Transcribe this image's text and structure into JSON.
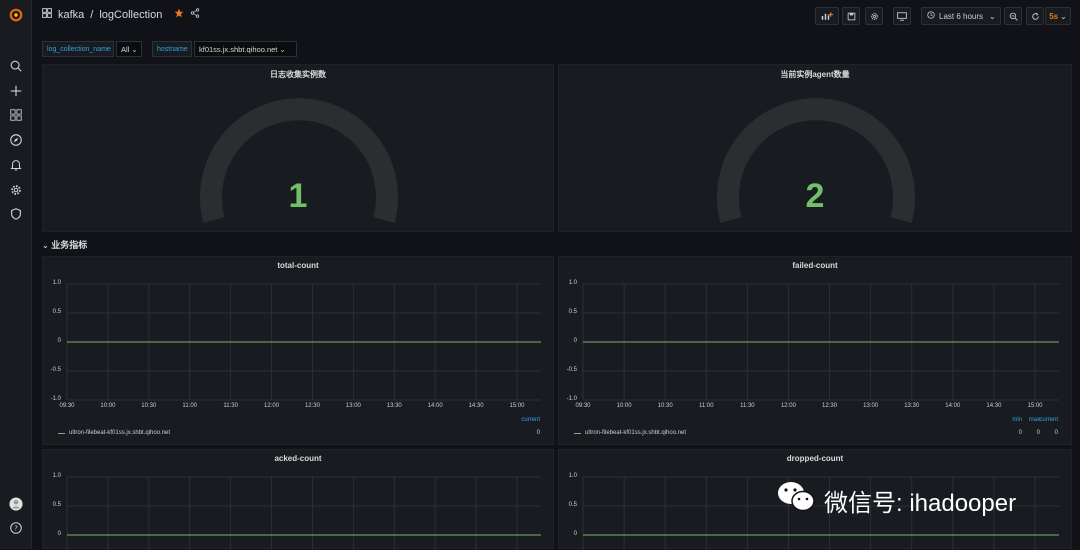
{
  "breadcrumb": {
    "folder": "kafka",
    "sep": "/",
    "dashboard": "logCollection"
  },
  "toolbar": {
    "time_range": "Last 6 hours",
    "refresh": "5s"
  },
  "variables": [
    {
      "label": "log_collection_name",
      "value": "All"
    },
    {
      "label": "hostname",
      "value": "kf01ss.jx.shbt.qihoo.net"
    }
  ],
  "gauges": [
    {
      "title": "日志收集实例数",
      "value": "1"
    },
    {
      "title": "当前实例agent数量",
      "value": "2"
    }
  ],
  "row_title": "业务指标",
  "graphs": [
    {
      "title": "total-count",
      "legend_headers": [
        "current"
      ],
      "legend_series": "ultron-filebeat-kf01ss.jx.shbt.qihoo.net",
      "legend_values": [
        "0"
      ]
    },
    {
      "title": "failed-count",
      "legend_headers": [
        "min",
        "max",
        "current"
      ],
      "legend_series": "ultron-filebeat-kf01ss.jx.shbt.qihoo.net",
      "legend_values": [
        "0",
        "0",
        "0"
      ]
    },
    {
      "title": "acked-count"
    },
    {
      "title": "dropped-count"
    }
  ],
  "y_ticks": [
    "1.0",
    "0.5",
    "0",
    "-0.5",
    "-1.0"
  ],
  "x_ticks": [
    "09:30",
    "10:00",
    "10:30",
    "11:00",
    "11:30",
    "12:00",
    "12:30",
    "13:00",
    "13:30",
    "14:00",
    "14:30",
    "15:00"
  ],
  "watermark": "微信号: ihadooper",
  "colors": {
    "accent": "#33a2e5",
    "gauge_value": "#73bf69",
    "star": "#eb7b18",
    "logo": "#f46800"
  }
}
